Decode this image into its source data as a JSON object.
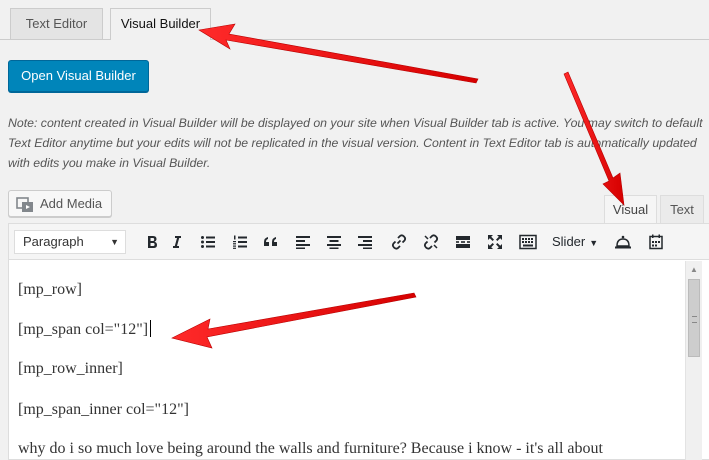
{
  "builder_tabs": {
    "text_editor": "Text Editor",
    "visual_builder": "Visual Builder"
  },
  "open_button": "Open Visual Builder",
  "note": "Note: content created in Visual Builder will be displayed on your site when Visual Builder tab is active. You may switch to default Text Editor anytime but your edits will not be replicated in the visual version. Content in Text Editor tab is automatically updated with edits you make in Visual Builder.",
  "add_media": "Add Media",
  "editor_tabs": {
    "visual": "Visual",
    "text": "Text"
  },
  "toolbar": {
    "format_value": "Paragraph",
    "slider_label": "Slider",
    "buttons": [
      "bold",
      "italic",
      "bulleted-list",
      "numbered-list",
      "blockquote",
      "align-left",
      "align-center",
      "align-right",
      "insert-link",
      "remove-link",
      "read-more",
      "fullscreen",
      "toolbar-toggle",
      "slider-dropdown",
      "shortcode",
      "calendar"
    ]
  },
  "content_lines": [
    "[mp_row]",
    "[mp_span col=\"12\"]",
    "[mp_row_inner]",
    "[mp_span_inner col=\"12\"]",
    "why do i so much love being around the walls and furniture? Because i know - it's all about"
  ],
  "annotation_color": "#ee1111"
}
